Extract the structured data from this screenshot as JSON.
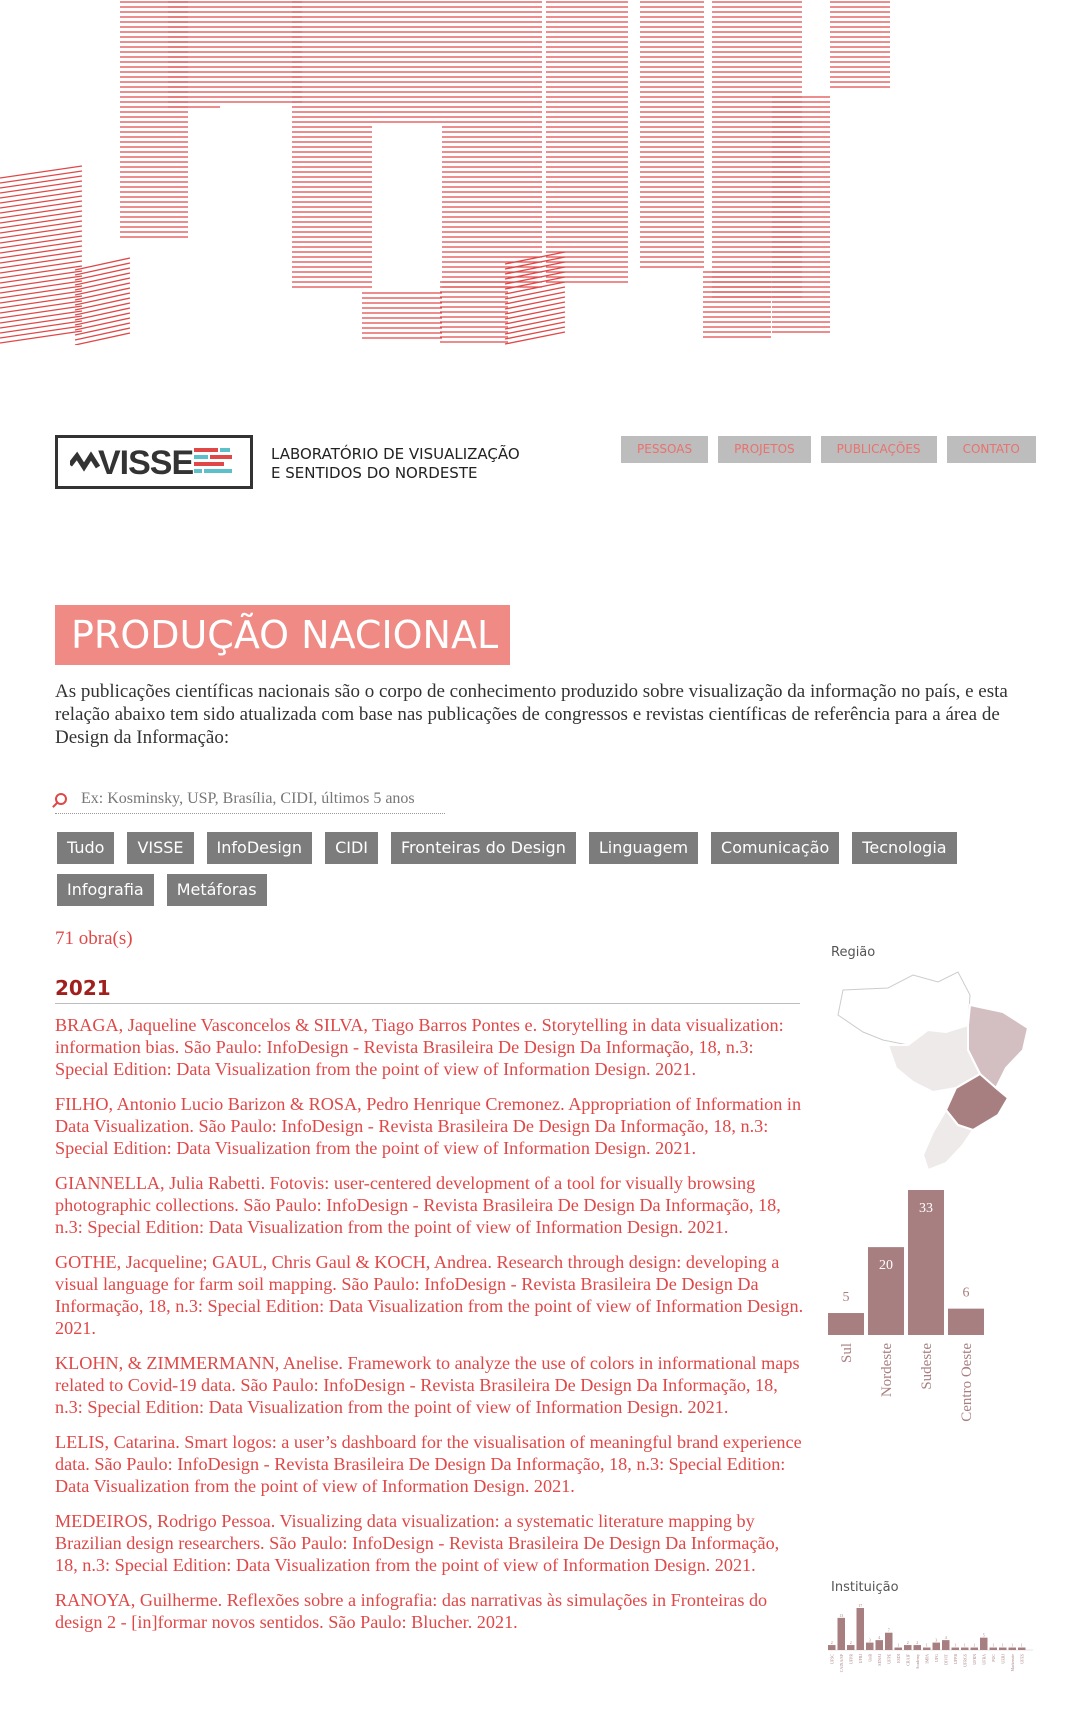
{
  "colors": {
    "accent": "#e04848",
    "title_bg": "#f08a84",
    "chart": "#a87f81",
    "nav_bg": "#bdbdbd",
    "filter_bg": "#7c7c7c"
  },
  "logo": {
    "word": "VISSE",
    "tagline_line1": "LABORATÓRIO DE VISUALIZAÇÃO",
    "tagline_line2": "E SENTIDOS DO NORDESTE"
  },
  "nav": [
    "PESSOAS",
    "PROJETOS",
    "PUBLICAÇÕES",
    "CONTATO"
  ],
  "page_title": "PRODUÇÃO NACIONAL",
  "intro": "As publicações científicas nacionais são o corpo de conhecimento produzido sobre visualização da informação no país, e esta relação abaixo tem sido atualizada com base nas publicações de congressos e revistas científicas de referência para a área de Design da Informação:",
  "search": {
    "icon": "search-icon",
    "placeholder": "Ex: Kosminsky, USP, Brasília, CIDI, últimos 5 anos"
  },
  "filters": [
    "Tudo",
    "VISSE",
    "InfoDesign",
    "CIDI",
    "Fronteiras do Design",
    "Linguagem",
    "Comunicação",
    "Tecnologia",
    "Infografia",
    "Metáforas"
  ],
  "count": "71 obra(s)",
  "year": "2021",
  "publications": [
    "BRAGA, Jaqueline Vasconcelos & SILVA, Tiago Barros Pontes e. Storytelling in data visualization: information bias. São Paulo: InfoDesign - Revista Brasileira De Design Da Informação, 18, n.3: Special Edition: Data Visualization from the point of view of Information Design. 2021.",
    "FILHO, Antonio Lucio Barizon & ROSA, Pedro Henrique Cremonez. Appropriation of Information in Data Visualization. São Paulo: InfoDesign - Revista Brasileira De Design Da Informação, 18, n.3: Special Edition: Data Visualization from the point of view of Information Design. 2021.",
    "GIANNELLA, Julia Rabetti. Fotovis: user-centered development of a tool for visually browsing photographic collections. São Paulo: InfoDesign - Revista Brasileira De Design Da Informação, 18, n.3: Special Edition: Data Visualization from the point of view of Information Design. 2021.",
    "GOTHE, Jacqueline; GAUL, Chris Gaul & KOCH, Andrea. Research through design: developing a visual language for farm soil mapping. São Paulo: InfoDesign - Revista Brasileira De Design Da Informação, 18, n.3: Special Edition: Data Visualization from the point of view of Information Design. 2021.",
    "KLOHN, & ZIMMERMANN, Anelise. Framework to analyze the use of colors in informational maps related to Covid-19 data. São Paulo: InfoDesign - Revista Brasileira De Design Da Informação, 18, n.3: Special Edition: Data Visualization from the point of view of Information Design. 2021.",
    "LELIS, Catarina. Smart logos: a user’s dashboard for the visualisation of meaningful brand experience data. São Paulo: InfoDesign - Revista Brasileira De Design Da Informação, 18, n.3: Special Edition: Data Visualization from the point of view of Information Design. 2021.",
    "MEDEIROS, Rodrigo Pessoa. Visualizing data visualization: a systematic literature mapping by Brazilian design researchers. São Paulo: InfoDesign - Revista Brasileira De Design Da Informação, 18, n.3: Special Edition: Data Visualization from the point of view of Information Design. 2021.",
    "RANOYA, Guilherme. Reflexões sobre a infografia: das narrativas às simulações in Fronteiras do design 2 - [in]formar novos sentidos. São Paulo: Blucher. 2021."
  ],
  "sidebar": {
    "region_label": "Região",
    "institution_label": "Instituição"
  },
  "chart_data": [
    {
      "type": "bar",
      "title": "Região",
      "categories": [
        "Sul",
        "Nordeste",
        "Sudeste",
        "Centro Oeste"
      ],
      "values": [
        5,
        20,
        33,
        6
      ]
    },
    {
      "type": "bar",
      "title": "Instituição",
      "categories": [
        "UFSC",
        "CAIXA/SP",
        "UFPR",
        "UFRJ",
        "UnB",
        "SENAI",
        "UFPE",
        "ESDI",
        "CRAIF",
        "Academy",
        "IMPA",
        "UFG",
        "DIVIT",
        "UFPB",
        "UFRGS",
        "UFRN",
        "UFBA",
        "PUC",
        "UERJ",
        "Mackenzie",
        "UFES"
      ],
      "values": [
        2,
        13,
        2,
        17,
        3,
        4,
        7,
        1,
        2,
        2,
        1,
        3,
        4,
        1,
        1,
        1,
        5,
        1,
        1,
        1,
        1
      ]
    }
  ]
}
